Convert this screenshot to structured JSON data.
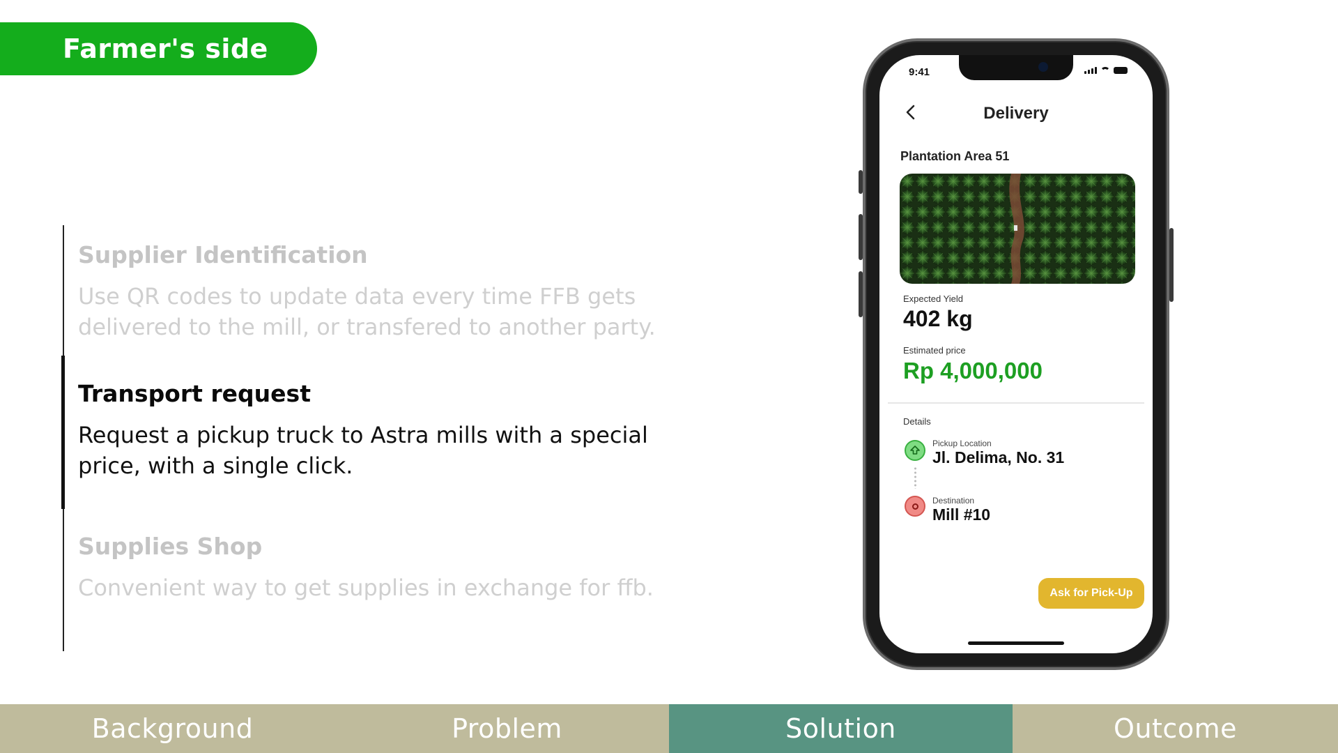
{
  "header": {
    "title": "Farmer's side"
  },
  "features": [
    {
      "title": "Supplier Identification",
      "description": "Use QR codes to update data every time FFB gets delivered to the mill, or transfered to another party.",
      "state": "inactive"
    },
    {
      "title": "Transport request",
      "description": "Request a pickup truck to Astra mills with a special price, with a single click.",
      "state": "active"
    },
    {
      "title": "Supplies Shop",
      "description": "Convenient way to get supplies in exchange for ffb.",
      "state": "inactive"
    }
  ],
  "phone": {
    "status_time": "9:41",
    "screen_title": "Delivery",
    "plantation_label": "Plantation Area 51",
    "expected_yield_label": "Expected Yield",
    "expected_yield_value": "402 kg",
    "estimated_price_label": "Estimated price",
    "estimated_price_value": "Rp 4,000,000",
    "details_label": "Details",
    "pickup_location_label": "Pickup Location",
    "pickup_location_value": "Jl. Delima, No. 31",
    "destination_label": "Destination",
    "destination_value": "Mill #10",
    "cta_label": "Ask for Pick-Up",
    "colors": {
      "price": "#1d9f22",
      "cta": "#e2b62e",
      "pickup": "#7fdc83",
      "destination": "#f08a86"
    }
  },
  "nav": {
    "items": [
      "Background",
      "Problem",
      "Solution",
      "Outcome"
    ],
    "active": "Solution",
    "colors": {
      "default": "#bfbb9c",
      "active": "#589482"
    }
  },
  "colors": {
    "accent": "#14ad1c"
  }
}
